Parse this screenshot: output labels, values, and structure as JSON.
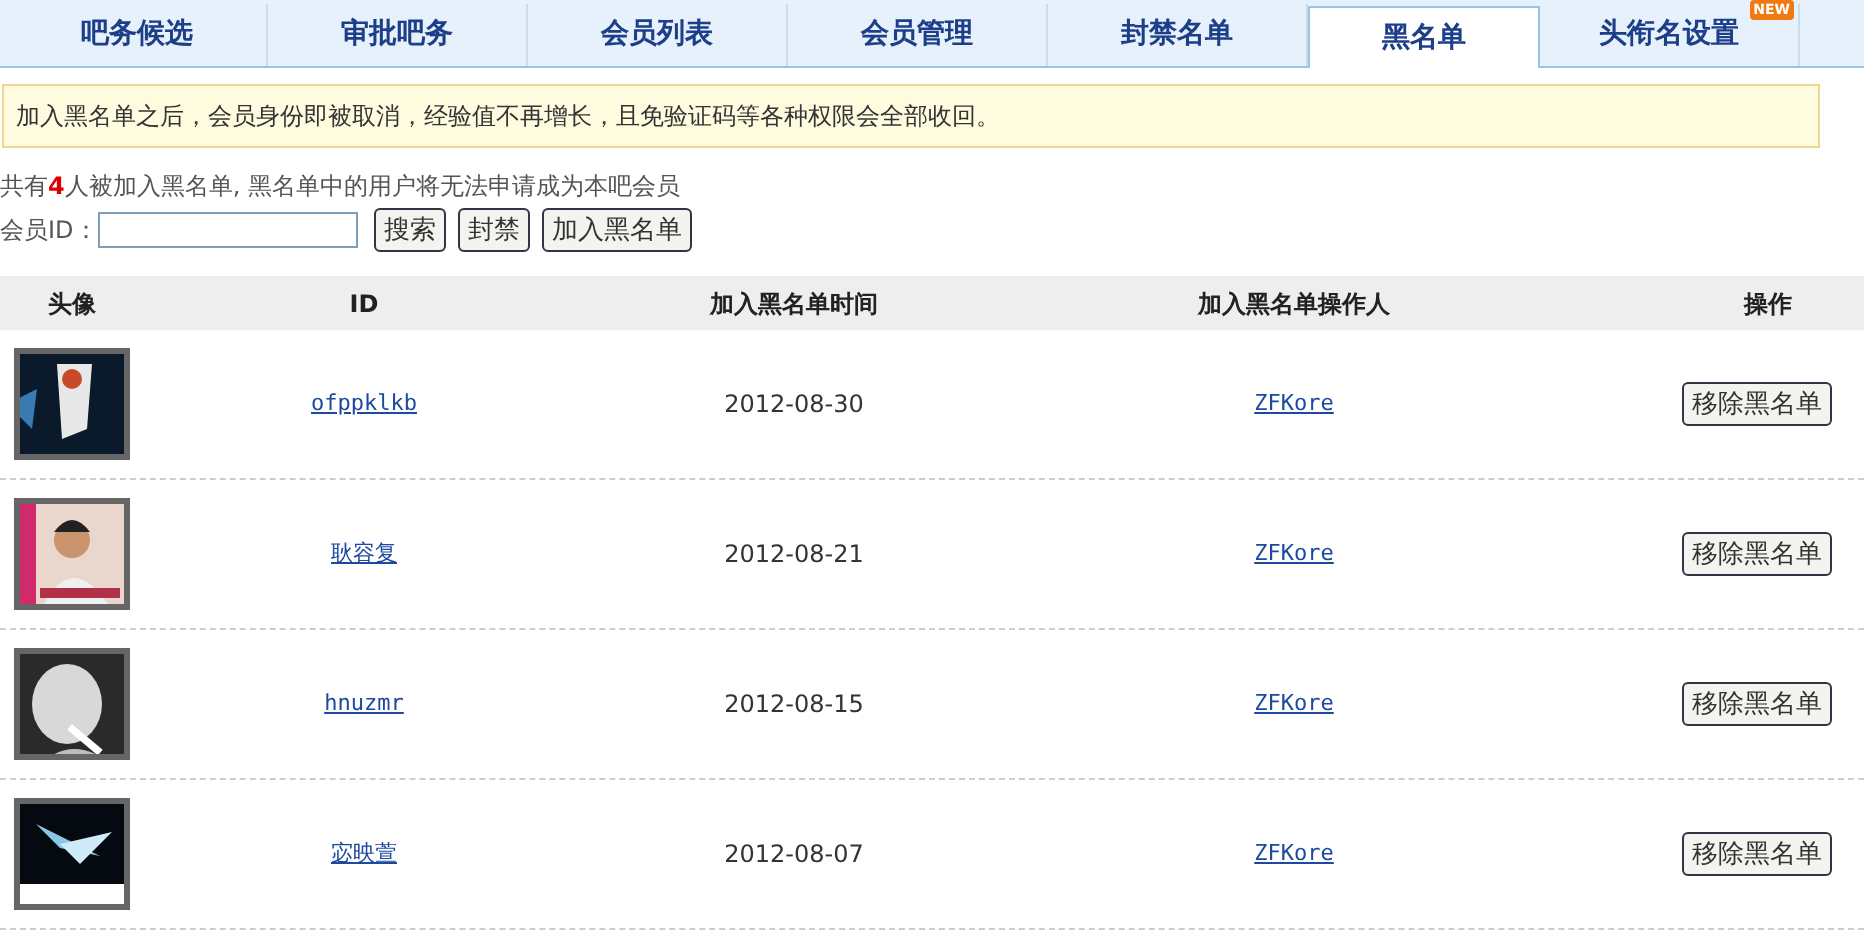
{
  "tabs": [
    {
      "label": "吧务候选",
      "selected": false
    },
    {
      "label": "审批吧务",
      "selected": false
    },
    {
      "label": "会员列表",
      "selected": false
    },
    {
      "label": "会员管理",
      "selected": false
    },
    {
      "label": "封禁名单",
      "selected": false
    },
    {
      "label": "黑名单",
      "selected": true
    },
    {
      "label": "头衔名设置",
      "selected": false,
      "badge": "NEW"
    }
  ],
  "notice": "加入黑名单之后，会员身份即被取消，经验值不再增长，且免验证码等各种权限会全部收回。",
  "summary": "共有**4**人被加入黑名单, 黑名单中的用户将无法申请成为本吧会员",
  "search": {
    "label": "会员ID：",
    "buttons": [
      "搜索",
      "封禁",
      "加入黑名单"
    ]
  },
  "table": {
    "columns": [
      "头像",
      "ID",
      "加入黑名单时间",
      "加入黑名单操作人",
      "操作"
    ],
    "rows": [
      {
        "id": "ofppklkb",
        "time": "2012-08-30",
        "operator": "ZFKore",
        "action": "移除黑名单"
      },
      {
        "id": "耿容复",
        "time": "2012-08-21",
        "operator": "ZFKore",
        "action": "移除黑名单"
      },
      {
        "id": "hnuzmr",
        "time": "2012-08-15",
        "operator": "ZFKore",
        "action": "移除黑名单"
      },
      {
        "id": "宓映萱",
        "time": "2012-08-07",
        "operator": "ZFKore",
        "action": "移除黑名单"
      }
    ]
  }
}
